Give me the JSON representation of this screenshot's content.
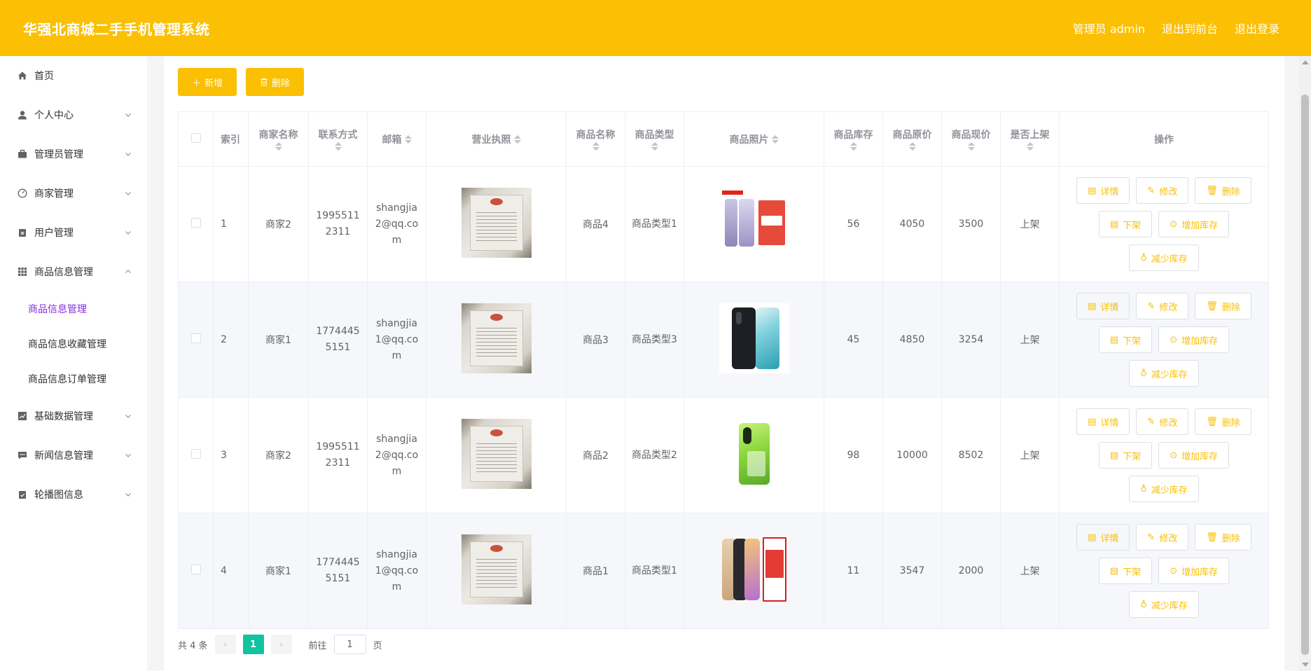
{
  "header": {
    "title": "华强北商城二手手机管理系统",
    "admin_label": "管理员 admin",
    "to_front": "退出到前台",
    "logout": "退出登录"
  },
  "sidebar": {
    "items": [
      {
        "label": "首页",
        "icon": "home-icon"
      },
      {
        "label": "个人中心",
        "icon": "user-icon"
      },
      {
        "label": "管理员管理",
        "icon": "briefcase-icon"
      },
      {
        "label": "商家管理",
        "icon": "gauge-icon"
      },
      {
        "label": "用户管理",
        "icon": "clipboard-x-icon"
      },
      {
        "label": "商品信息管理",
        "icon": "grid-icon"
      },
      {
        "label": "基础数据管理",
        "icon": "chart-icon"
      },
      {
        "label": "新闻信息管理",
        "icon": "message-icon"
      },
      {
        "label": "轮播图信息",
        "icon": "clipboard-check-icon"
      }
    ],
    "submenu": [
      "商品信息管理",
      "商品信息收藏管理",
      "商品信息订单管理"
    ]
  },
  "toolbar": {
    "add_label": "新增",
    "delete_label": "删除"
  },
  "table": {
    "columns": [
      "索引",
      "商家名称",
      "联系方式",
      "邮箱",
      "营业执照",
      "商品名称",
      "商品类型",
      "商品照片",
      "商品库存",
      "商品原价",
      "商品现价",
      "是否上架",
      "操作"
    ],
    "rows": [
      {
        "index": "1",
        "merchant": "商家2",
        "phone": "19955112311",
        "email": "shangjia2@qq.com",
        "product": "商品4",
        "type": "商品类型1",
        "stock": "56",
        "original_price": "4050",
        "current_price": "3500",
        "status": "上架"
      },
      {
        "index": "2",
        "merchant": "商家1",
        "phone": "17744455151",
        "email": "shangjia1@qq.com",
        "product": "商品3",
        "type": "商品类型3",
        "stock": "45",
        "original_price": "4850",
        "current_price": "3254",
        "status": "上架"
      },
      {
        "index": "3",
        "merchant": "商家2",
        "phone": "19955112311",
        "email": "shangjia2@qq.com",
        "product": "商品2",
        "type": "商品类型2",
        "stock": "98",
        "original_price": "10000",
        "current_price": "8502",
        "status": "上架"
      },
      {
        "index": "4",
        "merchant": "商家1",
        "phone": "17744455151",
        "email": "shangjia1@qq.com",
        "product": "商品1",
        "type": "商品类型1",
        "stock": "11",
        "original_price": "3547",
        "current_price": "2000",
        "status": "上架"
      }
    ],
    "actions": {
      "detail": "详情",
      "edit": "修改",
      "delete": "删除",
      "unlist": "下架",
      "add_stock": "增加库存",
      "reduce_stock": "减少库存"
    }
  },
  "pagination": {
    "total": "共 4 条",
    "current_page": "1",
    "goto_label": "前往",
    "goto_value": "1",
    "page_suffix": "页"
  },
  "colors": {
    "accent": "#fbbf04",
    "active_menu": "#8a2be2",
    "page_active": "#13c2a0"
  }
}
